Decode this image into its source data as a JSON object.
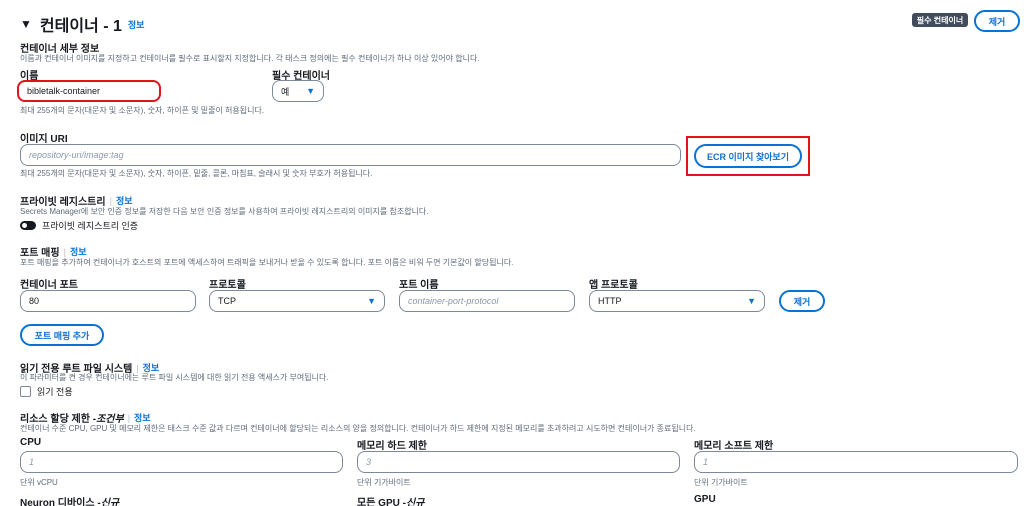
{
  "header": {
    "toggle_glyph": "▼",
    "title": "컨테이너 - 1",
    "info": "정보",
    "required_badge": "필수 컨테이너",
    "remove_label": "제거"
  },
  "details": {
    "title": "컨테이너 세부 정보",
    "desc": "이름과 컨테이너 이미지를 지정하고 컨테이너를 필수로 표시할지 지정합니다. 각 태스크 정의에는 필수 컨테이너가 하나 이상 있어야 합니다.",
    "name_label": "이름",
    "name_value": "bibletalk-container",
    "name_hint": "최대 255개의 문자(대문자 및 소문자), 숫자, 하이픈 및 밑줄이 허용됩니다.",
    "essential_label": "필수 컨테이너",
    "essential_value": "예"
  },
  "image": {
    "label": "이미지 URI",
    "placeholder": "repository-uri/image:tag",
    "hint": "최대 255개의 문자(대문자 및 소문자), 숫자, 하이픈, 밑줄, 콜론, 마침표, 슬래시 및 숫자 부호가 허용됩니다.",
    "browse_label": "ECR 이미지 찾아보기"
  },
  "private_registry": {
    "label": "프라이빗 레지스트리",
    "info": "정보",
    "desc": "Secrets Manager에 보안 인증 정보를 저장한 다음 보안 인증 정보를 사용하여 프라이빗 레지스트리의 이미지를 참조합니다.",
    "toggle_label": "프라이빗 레지스트리 인증"
  },
  "port_mapping": {
    "label": "포트 매핑",
    "info": "정보",
    "desc": "포트 매핑을 추가하여 컨테이너가 호스트의 포트에 액세스하여 트래픽을 보내거나 받을 수 있도록 합니다. 포트 이름은 비워 두면 기본값이 할당됩니다.",
    "col_container_port": "컨테이너 포트",
    "col_protocol": "프로토콜",
    "col_port_name": "포트 이름",
    "col_app_protocol": "앱 프로토콜",
    "container_port_value": "80",
    "protocol_value": "TCP",
    "port_name_placeholder": "container-port-protocol",
    "app_protocol_value": "HTTP",
    "remove_label": "제거",
    "add_label": "포트 매핑 추가"
  },
  "readonly_fs": {
    "label": "읽기 전용 루트 파일 시스템",
    "info": "정보",
    "desc": "이 파라미터를 켠 경우 컨테이너에는 루트 파일 시스템에 대한 읽기 전용 액세스가 부여됩니다.",
    "checkbox_label": "읽기 전용"
  },
  "resources": {
    "label_main": "리소스 할당 제한 - ",
    "label_italic": "조건부",
    "info": "정보",
    "desc": "컨테이너 수준 CPU, GPU 및 메모리 제한은 태스크 수준 값과 다르며 컨테이너에 할당되는 리소스의 양을 정의합니다. 컨테이너가 하드 제한에 지정된 메모리를 초과하려고 시도하면 컨테이너가 종료됩니다.",
    "cpu_label": "CPU",
    "cpu_placeholder": "1",
    "cpu_unit": "단위 vCPU",
    "mem_hard_label": "메모리 하드 제한",
    "mem_hard_placeholder": "3",
    "mem_hard_unit": "단위 기가바이트",
    "mem_soft_label": "메모리 소프트 제한",
    "mem_soft_placeholder": "1",
    "mem_soft_unit": "단위 기가바이트"
  },
  "bottom": {
    "neuron_main": "Neuron 디바이스 - ",
    "neuron_italic": "신규",
    "gpu_all_main": "모든 GPU - ",
    "gpu_all_italic": "신규",
    "gpu_label": "GPU"
  },
  "colors": {
    "accent": "#0972d3",
    "highlight": "#e4121b",
    "badge_bg": "#414d5c"
  }
}
